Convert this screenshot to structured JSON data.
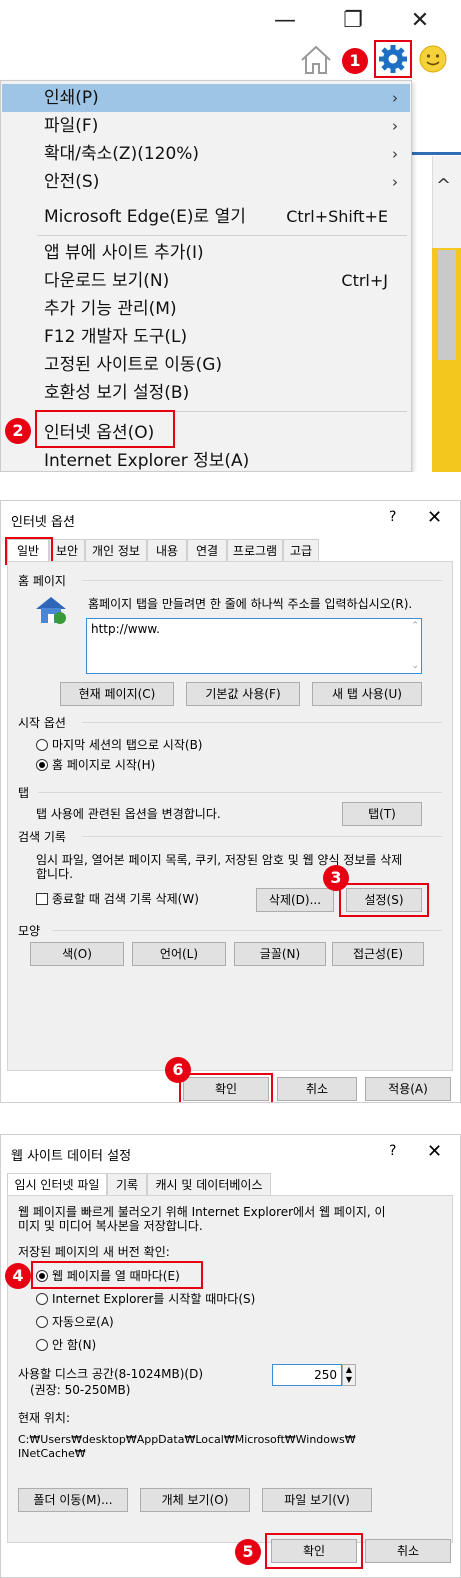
{
  "panel1": {
    "window_controls": {
      "minimize": "—",
      "restore": "❐",
      "close": "✕"
    },
    "menu_items": [
      {
        "label": "인쇄(P)",
        "arrow": "›"
      },
      {
        "label": "파일(F)",
        "arrow": "›"
      },
      {
        "label": "확대/축소(Z)(120%)",
        "arrow": "›"
      },
      {
        "label": "안전(S)",
        "arrow": "›"
      },
      {
        "label": "Microsoft Edge(E)로 열기",
        "shortcut": "Ctrl+Shift+E"
      },
      {
        "label": "앱 뷰에 사이트 추가(I)"
      },
      {
        "label": "다운로드 보기(N)",
        "shortcut": "Ctrl+J"
      },
      {
        "label": "추가 기능 관리(M)"
      },
      {
        "label": "F12 개발자 도구(L)"
      },
      {
        "label": "고정된 사이트로 이동(G)"
      },
      {
        "label": "호환성 보기 설정(B)"
      },
      {
        "label": "인터넷 옵션(O)"
      },
      {
        "label": "Internet Explorer 정보(A)"
      }
    ],
    "scroll_up": "^",
    "badges": {
      "one": "1",
      "two": "2"
    }
  },
  "panel2": {
    "title": "인터넷 옵션",
    "help": "?",
    "close": "✕",
    "tabs": [
      "일반",
      "보안",
      "개인 정보",
      "내용",
      "연결",
      "프로그램",
      "고급"
    ],
    "home": {
      "section": "홈 페이지",
      "desc": "홈페이지 탭을 만들려면 한 줄에 하나씩 주소를 입력하십시오(R).",
      "url": "http://www.",
      "buttons": [
        "현재 페이지(C)",
        "기본값 사용(F)",
        "새 탭 사용(U)"
      ]
    },
    "startup": {
      "section": "시작 옵션",
      "options": [
        "마지막 세션의 탭으로 시작(B)",
        "홈 페이지로 시작(H)"
      ]
    },
    "tabs_section": {
      "section": "탭",
      "desc": "탭 사용에 관련된 옵션을 변경합니다.",
      "button": "탭(T)"
    },
    "history": {
      "section": "검색 기록",
      "desc_line1": "임시 파일, 열어본 페이지 목록, 쿠키, 저장된 암호 및 웹 양식 정보를 삭제",
      "desc_line2": "합니다.",
      "checkbox": "종료할 때 검색 기록 삭제(W)",
      "delete": "삭제(D)...",
      "settings": "설정(S)"
    },
    "appearance": {
      "section": "모양",
      "buttons": [
        "색(O)",
        "언어(L)",
        "글꼴(N)",
        "접근성(E)"
      ]
    },
    "footer": [
      "확인",
      "취소",
      "적용(A)"
    ],
    "badges": {
      "three": "3",
      "six": "6"
    }
  },
  "panel3": {
    "title": "웹 사이트 데이터 설정",
    "help": "?",
    "close": "✕",
    "tabs": [
      "임시 인터넷 파일",
      "기록",
      "캐시 및 데이터베이스"
    ],
    "desc_line1": "웹 페이지를 빠르게 불러오기 위해 Internet Explorer에서 웹 페이지, 이",
    "desc_line2": "미지 및 미디어 복사본을 저장합니다.",
    "check_label": "저장된 페이지의 새 버전 확인:",
    "options": [
      "웹 페이지를 열 때마다(E)",
      "Internet Explorer를 시작할 때마다(S)",
      "자동으로(A)",
      "안 함(N)"
    ],
    "disk_label_1": "사용할 디스크 공간(8-1024MB)(D)",
    "disk_label_2": "(권장: 50-250MB)",
    "disk_value": "250",
    "location_label": "현재 위치:",
    "location_line1": "C:₩Users₩desktop₩AppData₩Local₩Microsoft₩Windows₩",
    "location_line2": "INetCache₩",
    "buttons": [
      "폴더 이동(M)...",
      "개체 보기(O)",
      "파일 보기(V)"
    ],
    "footer": [
      "확인",
      "취소"
    ],
    "badges": {
      "four": "4",
      "five": "5"
    }
  }
}
